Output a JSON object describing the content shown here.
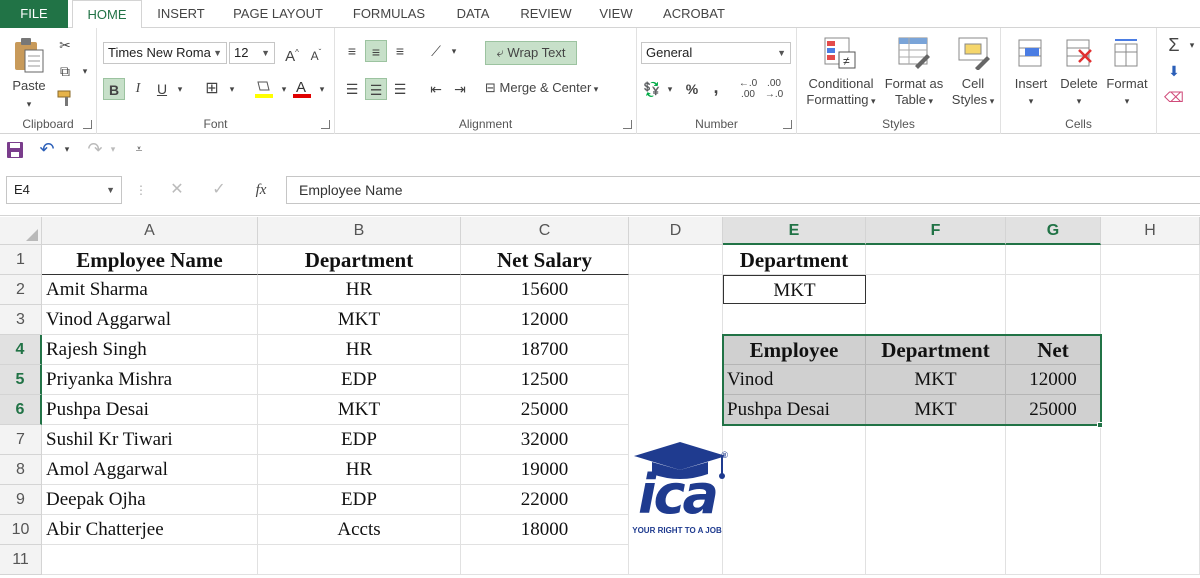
{
  "ribbon_tabs": [
    "FILE",
    "HOME",
    "INSERT",
    "PAGE LAYOUT",
    "FORMULAS",
    "DATA",
    "REVIEW",
    "VIEW",
    "ACROBAT"
  ],
  "clipboard": {
    "paste": "Paste",
    "label": "Clipboard"
  },
  "font": {
    "name": "Times New Roma",
    "size": "12",
    "bold": "B",
    "italic": "I",
    "underline": "U",
    "label": "Font"
  },
  "alignment": {
    "wrap": "Wrap Text",
    "merge": "Merge & Center",
    "label": "Alignment"
  },
  "number": {
    "format": "General",
    "percent": "%",
    "comma": ",",
    "label": "Number"
  },
  "styles": {
    "conditional": "Conditional",
    "conditional2": "Formatting",
    "format_as": "Format as",
    "format_as2": "Table",
    "cell": "Cell",
    "cell2": "Styles",
    "label": "Styles"
  },
  "cells": {
    "insert": "Insert",
    "delete": "Delete",
    "format": "Format",
    "label": "Cells"
  },
  "formula_bar": {
    "name_box": "E4",
    "fx": "fx",
    "content": "Employee Name"
  },
  "columns": [
    "A",
    "B",
    "C",
    "D",
    "E",
    "F",
    "G",
    "H"
  ],
  "rows": [
    "1",
    "2",
    "3",
    "4",
    "5",
    "6",
    "7",
    "8",
    "9",
    "10",
    "11"
  ],
  "table": {
    "headers": [
      "Employee Name",
      "Department",
      "Net Salary"
    ],
    "rows": [
      [
        "Amit Sharma",
        "HR",
        "15600"
      ],
      [
        "Vinod Aggarwal",
        "MKT",
        "12000"
      ],
      [
        "Rajesh Singh",
        "HR",
        "18700"
      ],
      [
        "Priyanka Mishra",
        "EDP",
        "12500"
      ],
      [
        "Pushpa Desai",
        "MKT",
        "25000"
      ],
      [
        "Sushil Kr Tiwari",
        "EDP",
        "32000"
      ],
      [
        "Amol Aggarwal",
        "HR",
        "19000"
      ],
      [
        "Deepak Ojha",
        "EDP",
        "22000"
      ],
      [
        "Abir Chatterjee",
        "Accts",
        "18000"
      ]
    ]
  },
  "criteria": {
    "header": "Department",
    "value": "MKT"
  },
  "result": {
    "headers": [
      "Employee",
      "Department",
      "Net"
    ],
    "rows": [
      [
        "Vinod",
        "MKT",
        "12000"
      ],
      [
        "Pushpa Desai",
        "MKT",
        "25000"
      ]
    ]
  },
  "logo": {
    "text": "ica",
    "tagline": "YOUR RIGHT TO A JOB",
    "registered": "®"
  },
  "colors": {
    "excel_green": "#217346",
    "logo_blue": "#1f3b8f",
    "selection_gray": "#d0d0d0"
  }
}
